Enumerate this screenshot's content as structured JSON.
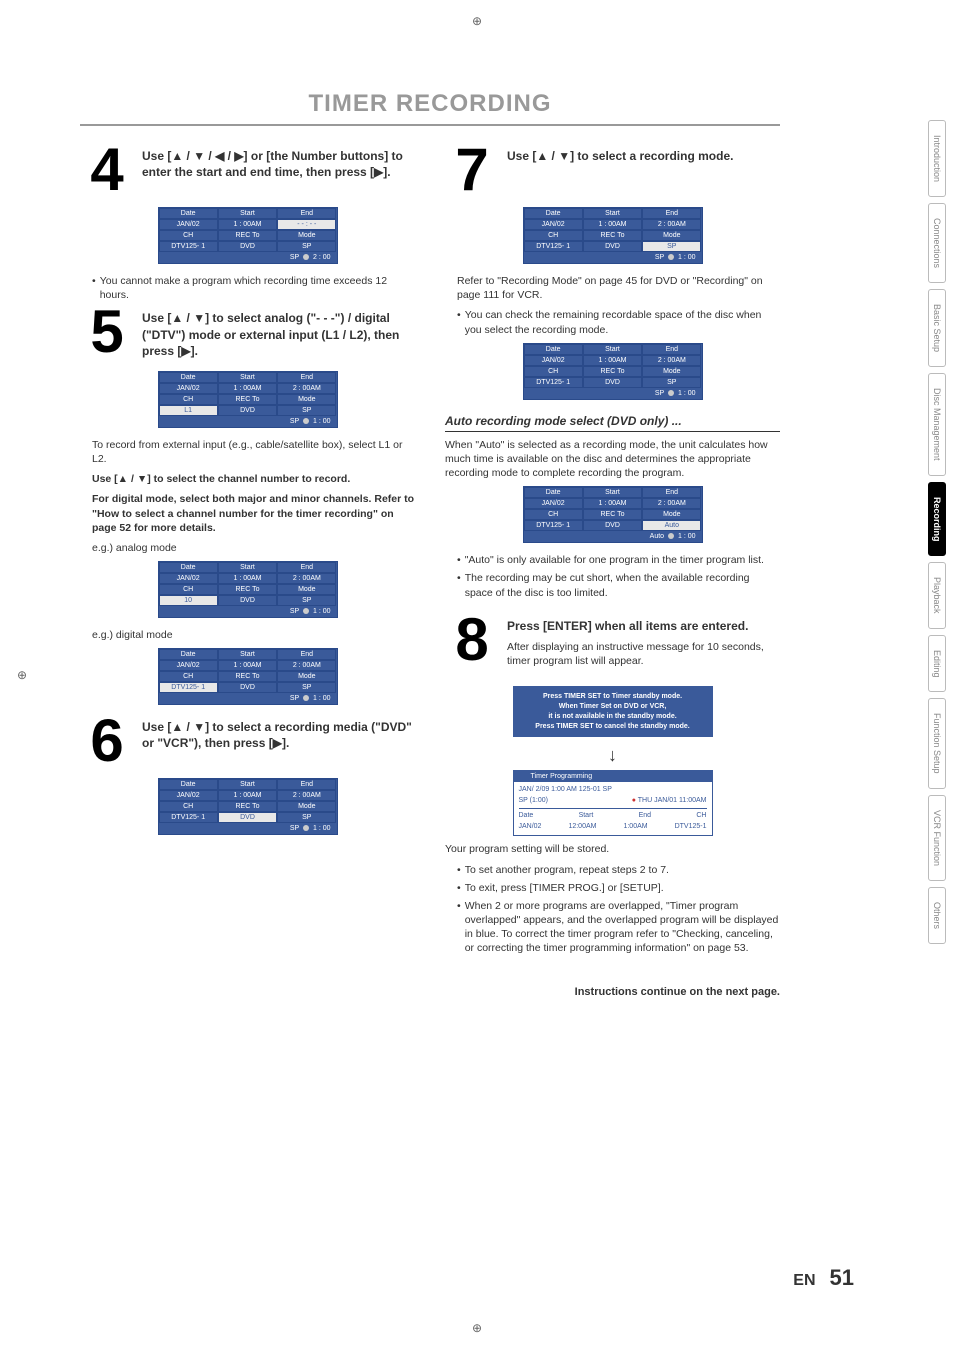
{
  "title": "TIMER RECORDING",
  "tabs": [
    "Introduction",
    "Connections",
    "Basic Setup",
    "Disc Management",
    "Recording",
    "Playback",
    "Editing",
    "Function Setup",
    "VCR Function",
    "Others"
  ],
  "active_tab": "Recording",
  "steps": {
    "s4": {
      "num": "4",
      "txt": "Use [▲ / ▼ / ◀ / ▶] or [the Number buttons] to enter the start and end time, then press [▶].",
      "bul1": "You cannot make a program which recording time exceeds 12 hours.",
      "mini": {
        "r1": [
          "Date",
          "Start",
          "End"
        ],
        "r2": [
          "JAN/02",
          "1 : 00AM",
          "- - : - -"
        ],
        "r3": [
          "CH",
          "REC To",
          "Mode"
        ],
        "r4": [
          "DTV125- 1",
          "DVD",
          "SP"
        ],
        "foot_l": "SP",
        "foot_r": "2 : 00"
      }
    },
    "s5": {
      "num": "5",
      "txt": "Use [▲ / ▼] to select analog (\"- - -\") / digital (\"DTV\") mode or external input (L1 / L2), then press [▶].",
      "note1": "To record from external input (e.g., cable/satellite box), select L1 or L2.",
      "b1": "Use [▲ / ▼] to select the channel number to record.",
      "b2": "For digital mode, select both major and minor channels.  Refer to \"How to select a channel number for the timer recording\" on page 52 for more details.",
      "eg_a": "e.g.) analog mode",
      "eg_d": "e.g.) digital mode",
      "mini1": {
        "r1": [
          "Date",
          "Start",
          "End"
        ],
        "r2": [
          "JAN/02",
          "1 : 00AM",
          "2 : 00AM"
        ],
        "r3": [
          "CH",
          "REC To",
          "Mode"
        ],
        "r4": [
          "L1",
          "DVD",
          "SP"
        ],
        "foot_l": "SP",
        "foot_r": "1 : 00"
      },
      "mini2": {
        "r1": [
          "Date",
          "Start",
          "End"
        ],
        "r2": [
          "JAN/02",
          "1 : 00AM",
          "2 : 00AM"
        ],
        "r3": [
          "CH",
          "REC To",
          "Mode"
        ],
        "r4": [
          "10",
          "DVD",
          "SP"
        ],
        "foot_l": "SP",
        "foot_r": "1 : 00"
      },
      "mini3": {
        "r1": [
          "Date",
          "Start",
          "End"
        ],
        "r2": [
          "JAN/02",
          "1 : 00AM",
          "2 : 00AM"
        ],
        "r3": [
          "CH",
          "REC To",
          "Mode"
        ],
        "r4": [
          "DTV125- 1",
          "DVD",
          "SP"
        ],
        "foot_l": "SP",
        "foot_r": "1 : 00"
      }
    },
    "s6": {
      "num": "6",
      "txt": "Use [▲ / ▼] to select a recording media (\"DVD\" or \"VCR\"), then press [▶].",
      "mini": {
        "r1": [
          "Date",
          "Start",
          "End"
        ],
        "r2": [
          "JAN/02",
          "1 : 00AM",
          "2 : 00AM"
        ],
        "r3": [
          "CH",
          "REC To",
          "Mode"
        ],
        "r4": [
          "DTV125- 1",
          "DVD",
          "SP"
        ],
        "foot_l": "SP",
        "foot_r": "1 : 00"
      }
    },
    "s7": {
      "num": "7",
      "txt": "Use [▲ / ▼] to select a recording mode.",
      "note1": "Refer to \"Recording Mode\" on page 45 for DVD or \"Recording\" on page 111 for VCR.",
      "bul1": "You can check the remaining recordable space of the disc when you select the recording mode.",
      "mini1": {
        "r1": [
          "Date",
          "Start",
          "End"
        ],
        "r2": [
          "JAN/02",
          "1 : 00AM",
          "2 : 00AM"
        ],
        "r3": [
          "CH",
          "REC To",
          "Mode"
        ],
        "r4": [
          "DTV125- 1",
          "DVD",
          "SP"
        ],
        "foot_l": "SP",
        "foot_r": "1 : 00"
      },
      "mini2": {
        "r1": [
          "Date",
          "Start",
          "End"
        ],
        "r2": [
          "JAN/02",
          "1 : 00AM",
          "2 : 00AM"
        ],
        "r3": [
          "CH",
          "REC To",
          "Mode"
        ],
        "r4": [
          "DTV125- 1",
          "DVD",
          "SP"
        ],
        "foot_l": "SP",
        "foot_r": "1 : 00"
      },
      "sub": "Auto recording mode select (DVD only) ...",
      "sub_txt": "When \"Auto\" is selected as a recording mode, the unit calculates how much time is available on the disc and determines the appropriate recording mode to complete recording the program.",
      "mini3": {
        "r1": [
          "Date",
          "Start",
          "End"
        ],
        "r2": [
          "JAN/02",
          "1 : 00AM",
          "2 : 00AM"
        ],
        "r3": [
          "CH",
          "REC To",
          "Mode"
        ],
        "r4": [
          "DTV125- 1",
          "DVD",
          "Auto"
        ],
        "foot_l": "Auto",
        "foot_r": "1 : 00"
      },
      "bul2": "\"Auto\" is only available for one program in the timer program list.",
      "bul3": "The recording may be cut short, when the available recording space of the disc is too limited."
    },
    "s8": {
      "num": "8",
      "txt1": "Press [ENTER] when all items are entered.",
      "txt2": "After displaying an instructive message for 10 seconds, timer program list will appear.",
      "msg": "Press TIMER SET to Timer standby mode.\nWhen Timer Set on DVD or VCR,\nit is not available in the standby mode.\nPress TIMER SET to cancel the standby mode.",
      "prog": {
        "title": "Timer Programming",
        "l1_l": "JAN/ 2/09 1:00 AM 125-01 SP",
        "l2_l": "SP (1:00)",
        "l2_r": "THU JAN/01 11:00AM",
        "hdr": [
          "Date",
          "Start",
          "End",
          "CH"
        ],
        "row": [
          "JAN/02",
          "12:00AM",
          "1:00AM",
          "DTV125-1"
        ]
      },
      "note1": "Your program setting will be stored.",
      "bul1": "To set another program, repeat steps 2 to 7.",
      "bul2": "To exit, press [TIMER PROG.] or [SETUP].",
      "bul3": "When 2 or more programs are overlapped, \"Timer program overlapped\" appears, and the overlapped program will be displayed in blue. To correct the timer program refer to \"Checking, canceling, or correcting the timer programming information\" on page 53."
    }
  },
  "cont": "Instructions continue on the next page.",
  "footer": {
    "lang": "EN",
    "page": "51"
  }
}
